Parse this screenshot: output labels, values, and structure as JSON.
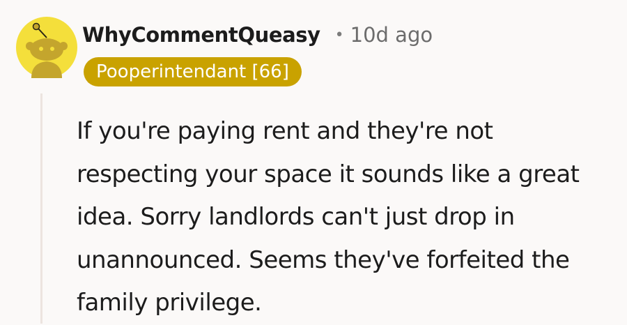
{
  "comment": {
    "username": "WhyCommentQueasy",
    "separator": "•",
    "timestamp": "10d ago",
    "flair": "Pooperintendant [66]",
    "body": "If you're paying rent and they're not respecting your space it sounds like a great idea. Sorry landlords can't just drop in unannounced. Seems they've forfeited the family privilege."
  },
  "avatar": {
    "icon": "snoo-avatar-icon",
    "background_color": "#f4df3b",
    "figure_color": "#c4a52d"
  },
  "colors": {
    "page_background": "#fbf9f8",
    "flair_background": "#c9a200",
    "flair_text": "#ffffff",
    "text_primary": "#1c1c1c",
    "text_secondary": "#6c6c6c",
    "thread_line": "#ece4df"
  }
}
